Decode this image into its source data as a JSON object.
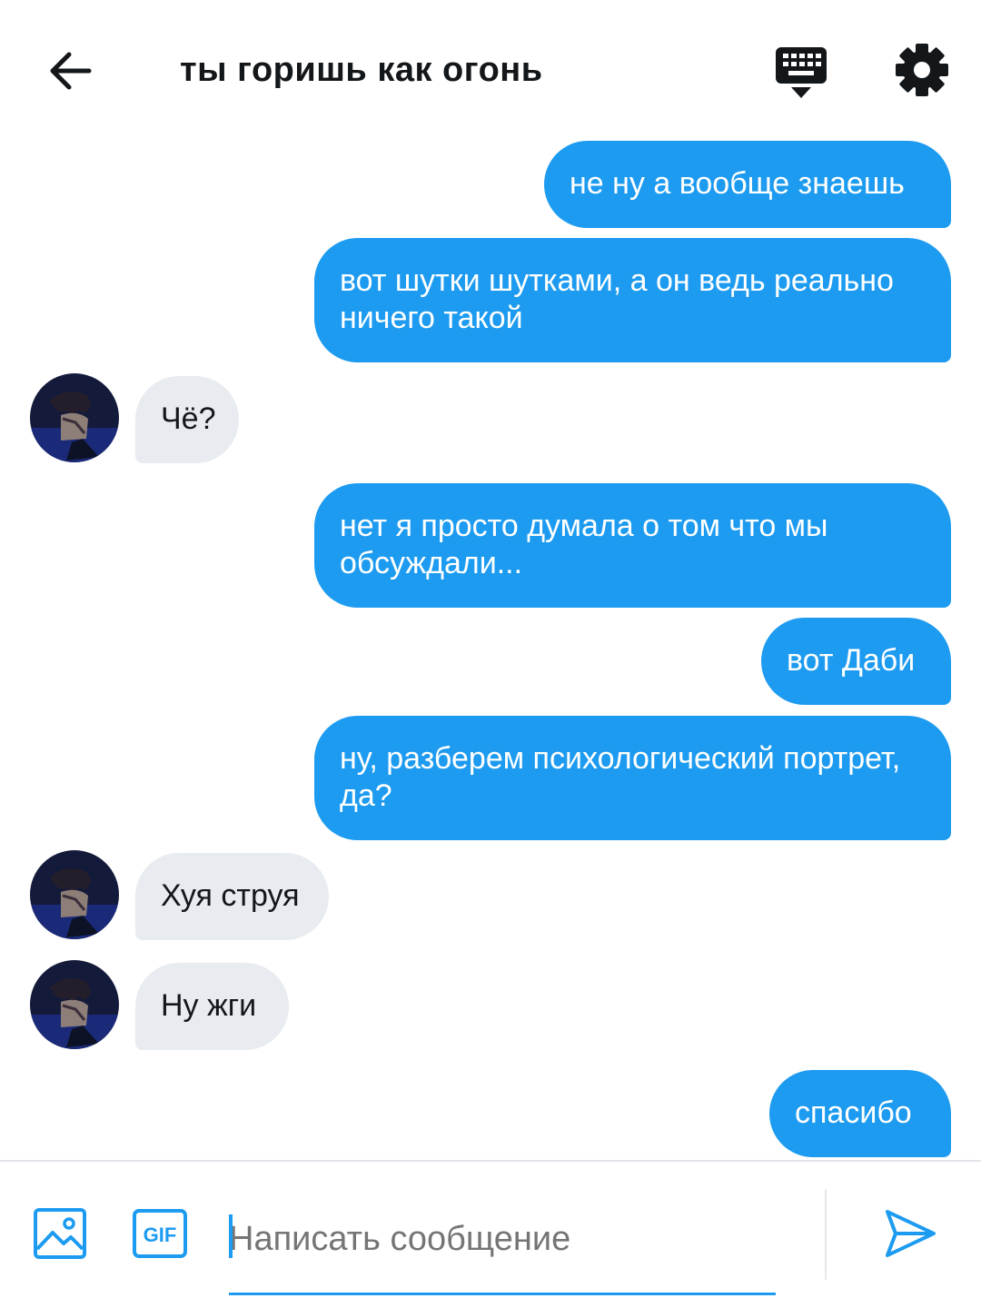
{
  "header": {
    "title": "ты горишь как огонь",
    "icons": {
      "back": "arrow-left-icon",
      "keyboard": "keyboard-icon",
      "settings": "gear-icon"
    }
  },
  "messages": [
    {
      "sender": "me",
      "text": "не ну а вообще знаешь"
    },
    {
      "sender": "me",
      "text": "вот шутки шутками, а он ведь реально ничего такой"
    },
    {
      "sender": "other",
      "text": "Чё?"
    },
    {
      "sender": "me",
      "text": "нет я просто думала о том что мы обсуждали..."
    },
    {
      "sender": "me",
      "text": "вот Даби"
    },
    {
      "sender": "me",
      "text": "ну, разберем психологический портрет, да?"
    },
    {
      "sender": "other",
      "text": "Хуя струя"
    },
    {
      "sender": "other",
      "text": "Ну жги"
    },
    {
      "sender": "me",
      "text": "спасибо"
    }
  ],
  "composer": {
    "placeholder": "Написать сообщение",
    "gif_label": "GIF",
    "icons": {
      "image": "image-icon",
      "gif": "gif-icon",
      "send": "send-icon"
    }
  },
  "colors": {
    "accent": "#1d9bf0",
    "incoming_bubble": "#e8ebef",
    "text": "#14171a",
    "placeholder": "#717b86"
  }
}
